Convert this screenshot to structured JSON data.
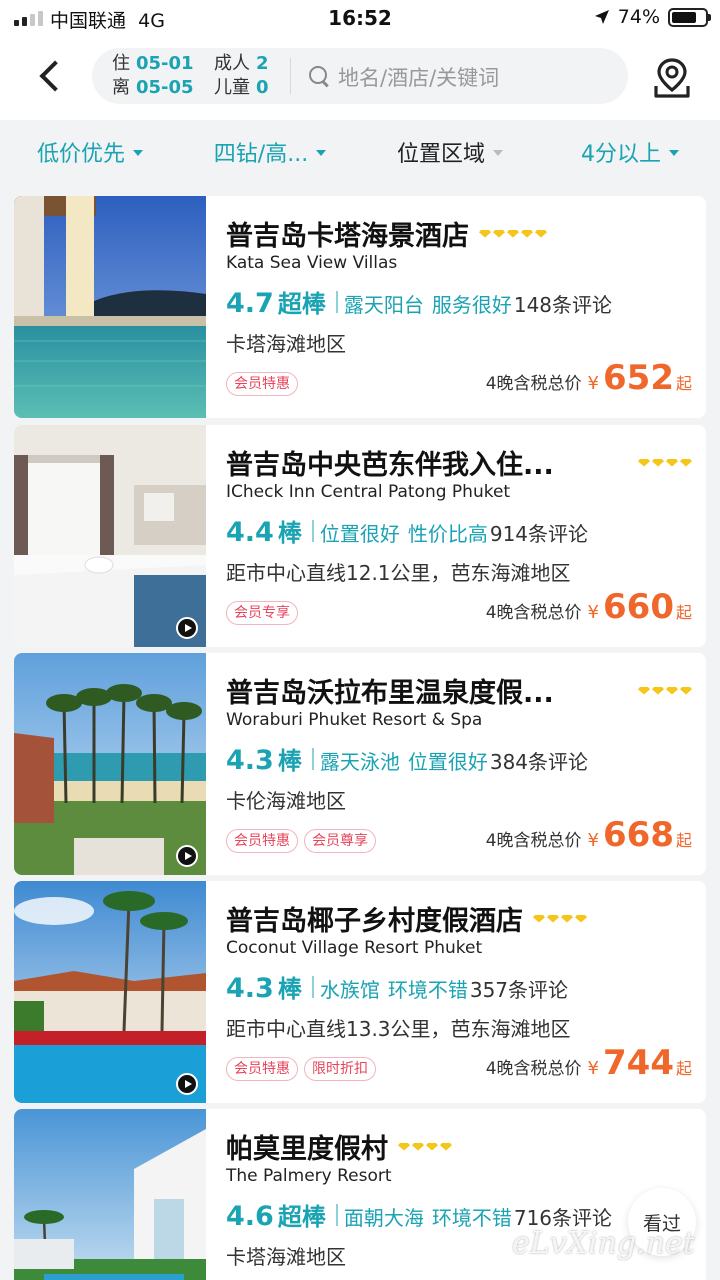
{
  "status_bar": {
    "carrier": "中国联通",
    "network": "4G",
    "time": "16:52",
    "battery": "74%",
    "battery_level": 0.74
  },
  "header": {
    "checkin_label": "住",
    "checkin_date": "05-01",
    "checkout_label": "离",
    "checkout_date": "05-05",
    "adults_label": "成人",
    "adults": "2",
    "children_label": "儿童",
    "children": "0",
    "search_placeholder": "地名/酒店/关键词"
  },
  "filters": [
    {
      "label": "低价优先",
      "active": true
    },
    {
      "label": "四钻/高...",
      "active": true
    },
    {
      "label": "位置区域",
      "active": false
    },
    {
      "label": "4分以上",
      "active": true
    }
  ],
  "hotels": [
    {
      "name": "普吉岛卡塔海景酒店",
      "en": "Kata Sea View Villas",
      "diamonds": 5,
      "score": "4.7",
      "grade": "超棒",
      "keywords": [
        "露天阳台",
        "服务很好"
      ],
      "reviews": "148条评论",
      "area": "卡塔海滩地区",
      "badges": [
        "会员特惠"
      ],
      "price_note": "4晚含税总价",
      "currency": "¥",
      "price": "652",
      "suffix": "起",
      "video": false
    },
    {
      "name": "普吉岛中央芭东伴我入住...",
      "en": "ICheck Inn Central Patong Phuket",
      "diamonds": 4,
      "score": "4.4",
      "grade": "棒",
      "keywords": [
        "位置很好",
        "性价比高"
      ],
      "reviews": "914条评论",
      "area": "距市中心直线12.1公里，芭东海滩地区",
      "badges": [
        "会员专享"
      ],
      "price_note": "4晚含税总价",
      "currency": "¥",
      "price": "660",
      "suffix": "起",
      "video": true
    },
    {
      "name": "普吉岛沃拉布里温泉度假...",
      "en": "Woraburi Phuket Resort & Spa",
      "diamonds": 4,
      "score": "4.3",
      "grade": "棒",
      "keywords": [
        "露天泳池",
        "位置很好"
      ],
      "reviews": "384条评论",
      "area": "卡伦海滩地区",
      "badges": [
        "会员特惠",
        "会员尊享"
      ],
      "price_note": "4晚含税总价",
      "currency": "¥",
      "price": "668",
      "suffix": "起",
      "video": true
    },
    {
      "name": "普吉岛椰子乡村度假酒店",
      "en": "Coconut Village Resort Phuket",
      "diamonds": 4,
      "score": "4.3",
      "grade": "棒",
      "keywords": [
        "水族馆",
        "环境不错"
      ],
      "reviews": "357条评论",
      "area": "距市中心直线13.3公里，芭东海滩地区",
      "badges": [
        "会员特惠",
        "限时折扣"
      ],
      "price_note": "4晚含税总价",
      "currency": "¥",
      "price": "744",
      "suffix": "起",
      "video": true
    },
    {
      "name": "帕莫里度假村",
      "en": "The Palmery Resort",
      "diamonds": 4,
      "score": "4.6",
      "grade": "超棒",
      "keywords": [
        "面朝大海",
        "环境不错"
      ],
      "reviews": "716条评论",
      "area": "卡塔海滩地区",
      "badges": [],
      "price_note": "",
      "currency": "",
      "price": "",
      "suffix": "",
      "video": false
    }
  ],
  "floating": {
    "watched_label": "看过"
  },
  "watermark": "eLvXing.net",
  "colors": {
    "accent": "#1aa3b3",
    "price": "#f0672b",
    "badge": "#e9445a",
    "diamond": "#f5c518"
  }
}
